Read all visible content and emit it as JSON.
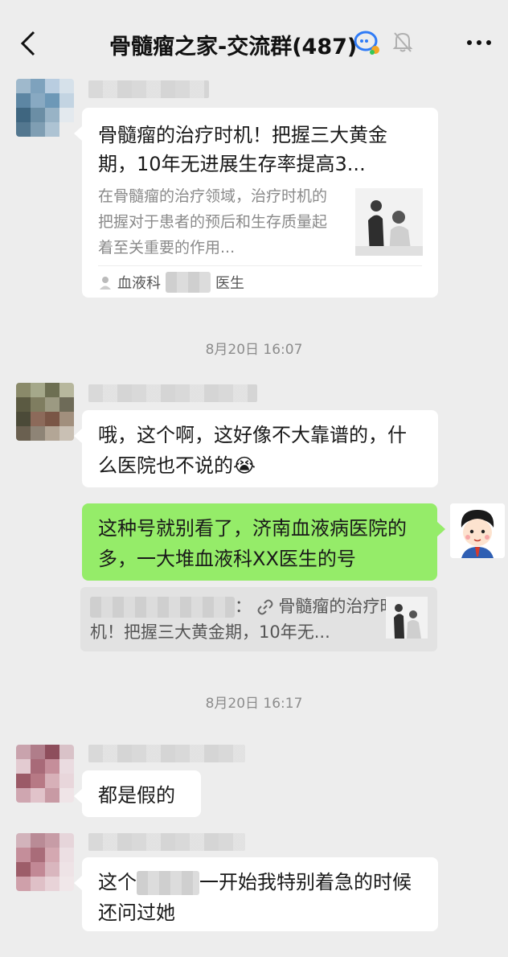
{
  "header": {
    "title": "骨髓瘤之家-交流群(487)"
  },
  "messages": {
    "card": {
      "title": "骨髓瘤的治疗时机！把握三大黄金期，10年无进展生存率提高3...",
      "description": "在骨髓瘤的治疗领域，治疗时机的把握对于患者的预后和生存质量起着至关重要的作用...",
      "source_prefix": "血液科",
      "source_suffix": "医生"
    },
    "ts1": "8月20日 16:07",
    "msg1": "哦，这个啊，这好像不大靠谱的，什么医院也不说的",
    "msg1_emoji": "😭",
    "msg2_self": "这种号就别看了，济南血液病医院的多，一大堆血液科XX医生的号",
    "quote": {
      "sep": "：",
      "text": "骨髓瘤的治疗时机！把握三大黄金期，10年无..."
    },
    "ts2": "8月20日 16:17",
    "msg3": "都是假的",
    "msg4_part1": "这个",
    "msg4_part2": "一开始我特别着急的时候 还问过她"
  },
  "colors": {
    "background": "#ededed",
    "bubble_self": "#95ec69",
    "bubble_other": "#ffffff"
  }
}
